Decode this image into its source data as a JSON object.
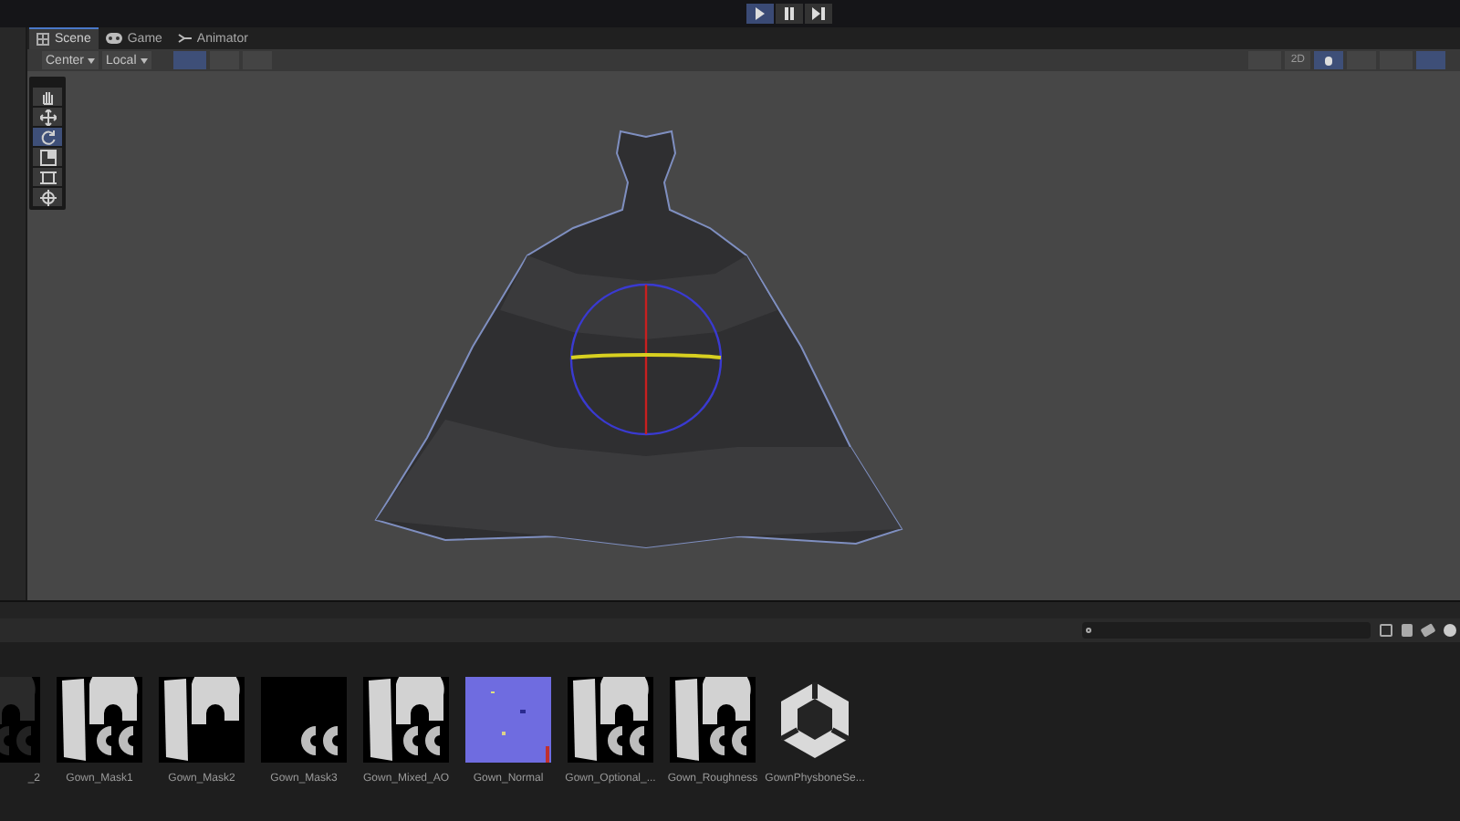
{
  "playbar": [
    {
      "kind": "play",
      "selected": true
    },
    {
      "kind": "pause",
      "selected": false
    },
    {
      "kind": "step",
      "selected": false
    }
  ],
  "tabs": [
    {
      "label": "Scene",
      "kind": "scene",
      "selected": true
    },
    {
      "label": "Game",
      "kind": "game",
      "selected": false
    },
    {
      "label": "Animator",
      "kind": "animator",
      "selected": false
    }
  ],
  "toolbar": {
    "pivot": "Center",
    "space": "Local",
    "mode_2d": {
      "label": "2D",
      "on": false
    },
    "lighting": {
      "on": true
    },
    "audio": {
      "on": false
    },
    "gizmos": {
      "on": true
    }
  },
  "tools": [
    {
      "kind": "hand",
      "selected": false
    },
    {
      "kind": "move",
      "selected": false
    },
    {
      "kind": "rotate",
      "selected": true
    },
    {
      "kind": "scale",
      "selected": false
    },
    {
      "kind": "rect",
      "selected": false
    },
    {
      "kind": "transform",
      "selected": false
    }
  ],
  "assets": [
    {
      "name": "_2",
      "kind": "texture"
    },
    {
      "name": "Gown_Mask1",
      "kind": "texture"
    },
    {
      "name": "Gown_Mask2",
      "kind": "texture"
    },
    {
      "name": "Gown_Mask3",
      "kind": "texture"
    },
    {
      "name": "Gown_Mixed_AO",
      "kind": "texture"
    },
    {
      "name": "Gown_Normal",
      "kind": "normal"
    },
    {
      "name": "Gown_Optional_...",
      "kind": "texture"
    },
    {
      "name": "Gown_Roughness",
      "kind": "texture"
    },
    {
      "name": "GownPhysboneSe...",
      "kind": "prefab"
    }
  ]
}
